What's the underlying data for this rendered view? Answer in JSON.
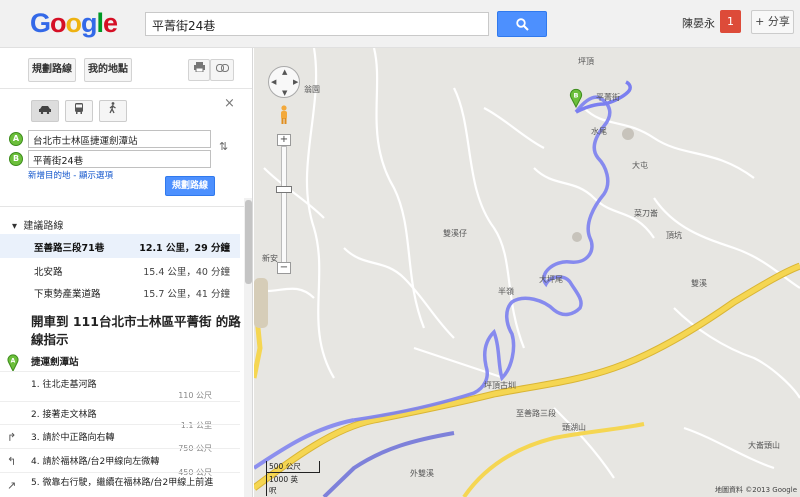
{
  "header": {
    "logo_letters": [
      "G",
      "o",
      "o",
      "g",
      "l",
      "e"
    ],
    "search_value": "平菁街24巷",
    "user_name": "陳晏永",
    "notification_count": "1",
    "share_label": "+ 分享"
  },
  "sidebar": {
    "get_directions_label": "規劃路線",
    "my_maps_label": "我的地點",
    "print_icon": "printer-icon",
    "link_icon": "link-icon",
    "modes": [
      "car-icon",
      "bus-icon",
      "walk-icon"
    ],
    "close_label": "×",
    "start_marker": "A",
    "start_value": "台北市士林區捷運劍潭站",
    "end_marker": "B",
    "end_value": "平菁街24巷",
    "add_destination_text": "新增目的地 - 顯示選項",
    "go_button_label": "規劃路線",
    "suggested_routes_title": "建議路線",
    "routes": [
      {
        "name": "至善路三段71巷",
        "distance": "12.1 公里，29 分鐘",
        "selected": true
      },
      {
        "name": "北安路",
        "distance": "15.4 公里，40 分鐘",
        "selected": false
      },
      {
        "name": "下東勢產業道路",
        "distance": "15.7 公里，41 分鐘",
        "selected": false
      }
    ],
    "directions_title": "開車到 111台北市士林區平菁街 的路線指示",
    "start_label": "捷運劍潭站",
    "steps": [
      {
        "text": "1. 往北走基河路",
        "distance": "110 公尺"
      },
      {
        "text": "2. 接著走文林路",
        "distance": "1.1 公里"
      },
      {
        "text": "3. 請於中正路向右轉",
        "distance": "750 公尺"
      },
      {
        "text": "4. 請於福林路/台2甲線向左微轉",
        "distance": "450 公尺"
      },
      {
        "text": "5. 微靠右行駛，繼續在福林路/台2甲線上前進",
        "distance": ""
      }
    ]
  },
  "map": {
    "destination_marker": "B",
    "labels": [
      "坪頂",
      "平菁街",
      "水尾",
      "大屯",
      "大坪尾",
      "菜刀崙",
      "雙溪仔",
      "頂坑",
      "半嶺",
      "雙溪",
      "頭湖山",
      "新安",
      "翁園",
      "坪頂古圳",
      "大崙頭山",
      "外雙溪",
      "中社路",
      "至善路三段"
    ],
    "scale_top": "500 公尺",
    "scale_bottom": "1000 英呎",
    "copyright": "地圖資料 ©2013 Google",
    "route_color": "#7b7ff0",
    "highway_color": "#f5d652"
  }
}
